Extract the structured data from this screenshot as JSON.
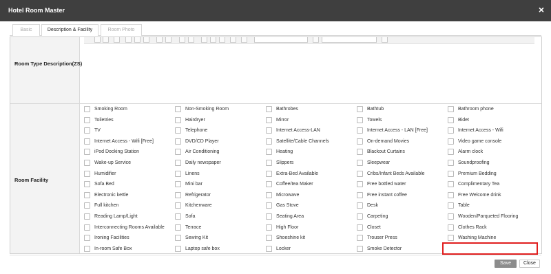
{
  "window": {
    "title": "Hotel Room Master",
    "close_icon": "×"
  },
  "tabs": [
    {
      "label": "Basic",
      "active": false
    },
    {
      "label": "Description & Facility",
      "active": true
    },
    {
      "label": "Room Photo",
      "active": false
    }
  ],
  "description": {
    "label": "Room Type Description(ZS)"
  },
  "facility": {
    "label": "Room Facility",
    "columns": [
      [
        "Smoking Room",
        "Toiletries",
        "TV",
        "Internet Access - Wifi [Free]",
        "iPod Docking Station",
        "Wake-up Service",
        "Humidifier",
        "Sofa Bed",
        "Electronic kettle",
        "Full kitchen",
        "Reading Lamp/Light",
        "Interconnecting Rooms Available",
        "Ironing Facilities",
        "In-room Safe Box"
      ],
      [
        "Non-Smoking Room",
        "Hairdryer",
        "Telephone",
        "DVD/CD Player",
        "Air Conditioning",
        "Daily newspaper",
        "Linens",
        "Mini bar",
        "Refrigerator",
        "Kitchenware",
        "Sofa",
        "Terrace",
        "Sewing Kit",
        "Laptop safe box"
      ],
      [
        "Bathrobes",
        "Mirror",
        "Internet Access-LAN",
        "Satellite/Cable Channels",
        "Heating",
        "Slippers",
        "Extra-Bed Available",
        "Coffee/tea Maker",
        "Microwave",
        "Gas Stove",
        "Seating Area",
        "High Floor",
        "Shoeshine kit",
        "Locker"
      ],
      [
        "Bathtub",
        "Towels",
        "Internet Access - LAN [Free]",
        "On-demand Movies",
        "Blackout Curtains",
        "Sleepwear",
        "Cribs/Infant Beds Available",
        "Free bottled water",
        "Free instant coffee",
        "Desk",
        "Carpeting",
        "Closet",
        "Trouser Press",
        "Smoke Detector"
      ],
      [
        "Bathroom phone",
        "Bidet",
        "Internet Access - Wifi",
        "Video game console",
        "Alarm clock",
        "Soundproofing",
        "Premium Bedding",
        "Complimentary Tea",
        "Free Welcome drink",
        "Table",
        "Wooden/Parqueted Flooring",
        "Clothes Rack",
        "Washing Machine"
      ]
    ]
  },
  "footer": {
    "save_label": "Save",
    "close_label": "Close"
  }
}
